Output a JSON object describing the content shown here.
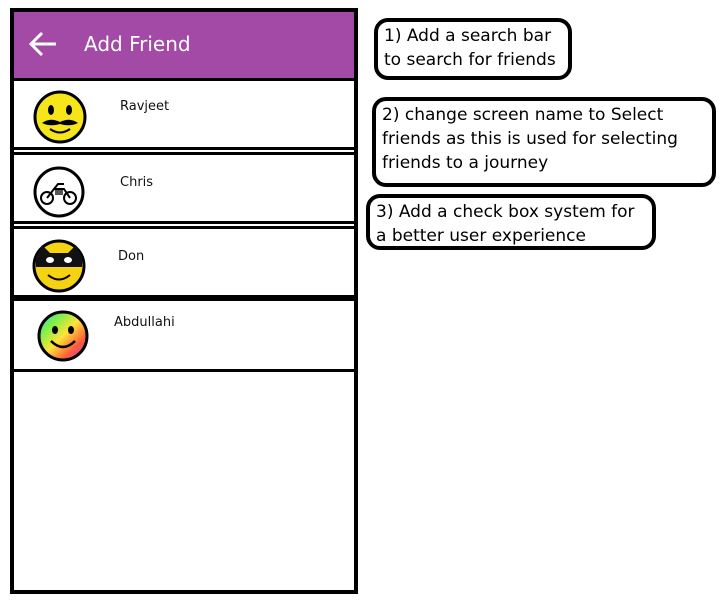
{
  "app": {
    "title": "Add Friend",
    "accent_color": "#a24aa6",
    "back_icon": "arrow-left-icon"
  },
  "friends": [
    {
      "name": "Ravjeet",
      "avatar": "mustache-smiley-icon"
    },
    {
      "name": "Chris",
      "avatar": "motorbike-smiley-icon"
    },
    {
      "name": "Don",
      "avatar": "masked-smiley-icon"
    },
    {
      "name": "Abdullahi",
      "avatar": "rainbow-smiley-icon"
    }
  ],
  "notes": [
    {
      "text": "1) Add a search bar to search for friends"
    },
    {
      "text": "2) change screen name to Select friends as this is used for selecting friends to a journey"
    },
    {
      "text": "3) Add a check box system for a better user experience"
    }
  ]
}
